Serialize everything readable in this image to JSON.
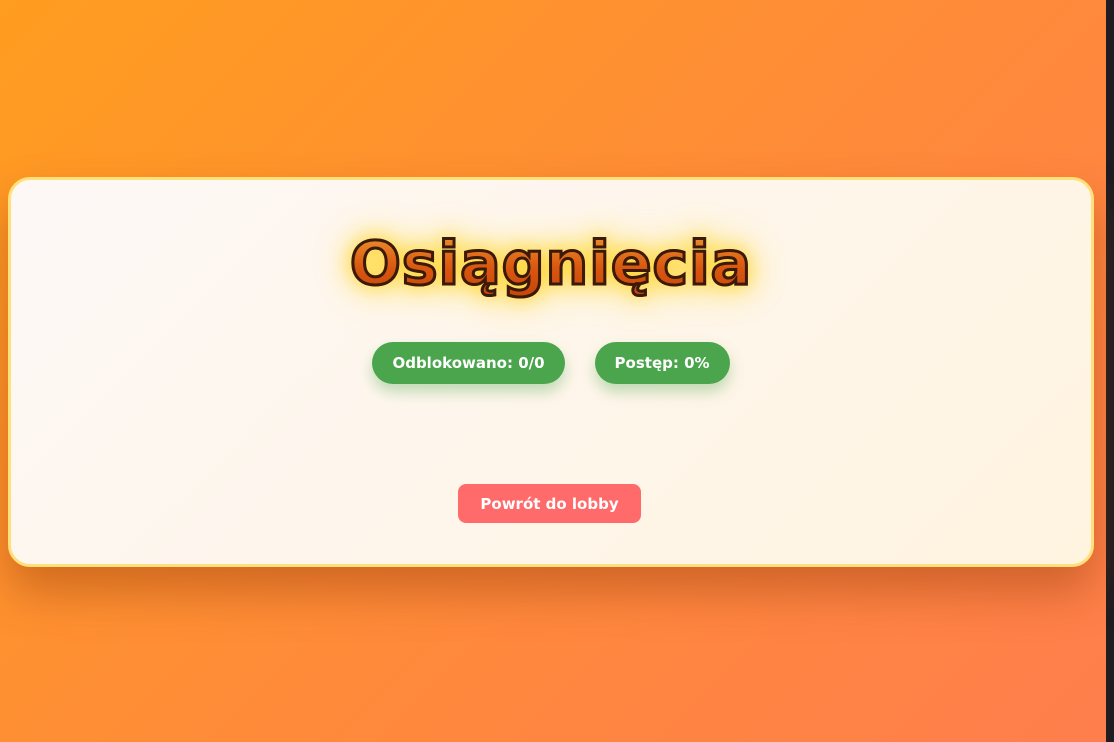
{
  "page": {
    "title": "Osiągnięcia"
  },
  "stats": {
    "unlocked": "Odblokowano: 0/0",
    "progress": "Postęp: 0%"
  },
  "actions": {
    "back_label": "Powrót do lobby"
  },
  "colors": {
    "background_start": "#ff9d1f",
    "background_end": "#ff7e4d",
    "panel_border": "#ffe07a",
    "badge": "#4aa54d",
    "back_button": "#ff6b6b",
    "title_glow": "#ffd228"
  }
}
